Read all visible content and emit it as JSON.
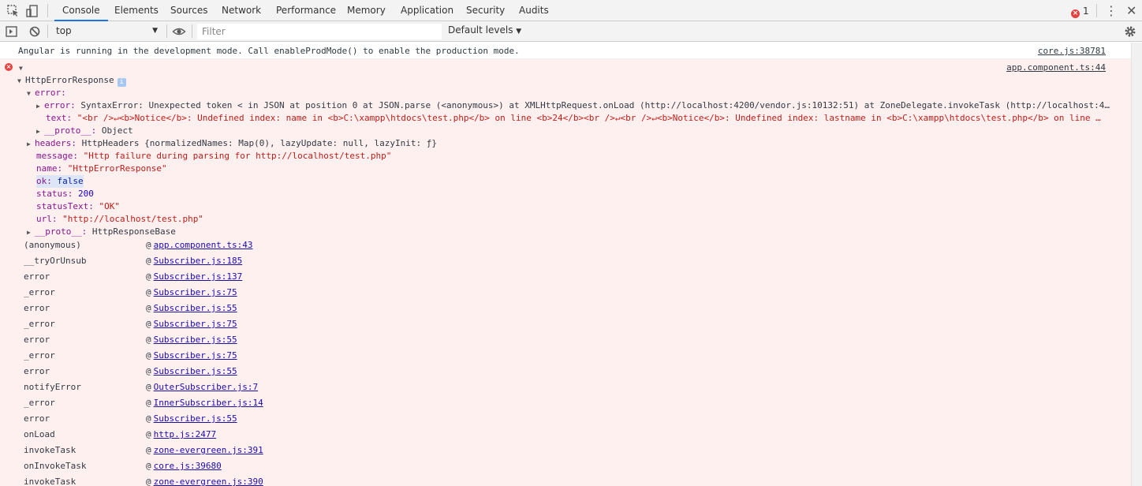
{
  "tabs": [
    "Console",
    "Elements",
    "Sources",
    "Network",
    "Performance",
    "Memory",
    "Application",
    "Security",
    "Audits"
  ],
  "error_count": "1",
  "filterbar": {
    "context": "top",
    "filter_placeholder": "Filter",
    "levels": "Default levels"
  },
  "log_message": {
    "text": "Angular is running in the development mode. Call enableProdMode() to enable the production mode.",
    "source": "core.js:38781"
  },
  "error_message": {
    "source": "app.component.ts:44",
    "object_name": "HttpErrorResponse",
    "error_key": "error:",
    "nested_error_key": "error:",
    "nested_error_value": "SyntaxError: Unexpected token < in JSON at position 0 at JSON.parse (<anonymous>) at XMLHttpRequest.onLoad (http://localhost:4200/vendor.js:10132:51) at ZoneDelegate.invokeTask (http://localhost:4…",
    "text_key": "text:",
    "text_value": "\"<br />↵<b>Notice</b>:  Undefined index: name in <b>C:\\xampp\\htdocs\\test.php</b> on line <b>24</b><br />↵<br />↵<b>Notice</b>:  Undefined index: lastname in <b>C:\\xampp\\htdocs\\test.php</b> on line …",
    "proto1_key": "__proto__:",
    "proto1_value": "Object",
    "headers_key": "headers:",
    "headers_value": "HttpHeaders {normalizedNames: Map(0), lazyUpdate: null, lazyInit: ƒ}",
    "message_key": "message:",
    "message_value": "\"Http failure during parsing for http://localhost/test.php\"",
    "name_key": "name:",
    "name_value": "\"HttpErrorResponse\"",
    "ok_key": "ok:",
    "ok_value": "false",
    "status_key": "status:",
    "status_value": "200",
    "statusText_key": "statusText:",
    "statusText_value": "\"OK\"",
    "url_key": "url:",
    "url_value": "\"http://localhost/test.php\"",
    "proto2_key": "__proto__:",
    "proto2_value": "HttpResponseBase"
  },
  "stack": [
    {
      "fn": "(anonymous)",
      "src": "app.component.ts:43"
    },
    {
      "fn": "__tryOrUnsub",
      "src": "Subscriber.js:185"
    },
    {
      "fn": "error",
      "src": "Subscriber.js:137"
    },
    {
      "fn": "_error",
      "src": "Subscriber.js:75"
    },
    {
      "fn": "error",
      "src": "Subscriber.js:55"
    },
    {
      "fn": "_error",
      "src": "Subscriber.js:75"
    },
    {
      "fn": "error",
      "src": "Subscriber.js:55"
    },
    {
      "fn": "_error",
      "src": "Subscriber.js:75"
    },
    {
      "fn": "error",
      "src": "Subscriber.js:55"
    },
    {
      "fn": "notifyError",
      "src": "OuterSubscriber.js:7"
    },
    {
      "fn": "_error",
      "src": "InnerSubscriber.js:14"
    },
    {
      "fn": "error",
      "src": "Subscriber.js:55"
    },
    {
      "fn": "onLoad",
      "src": "http.js:2477"
    },
    {
      "fn": "invokeTask",
      "src": "zone-evergreen.js:391"
    },
    {
      "fn": "onInvokeTask",
      "src": "core.js:39680"
    },
    {
      "fn": "invokeTask",
      "src": "zone-evergreen.js:390"
    }
  ],
  "at_symbol": "@"
}
